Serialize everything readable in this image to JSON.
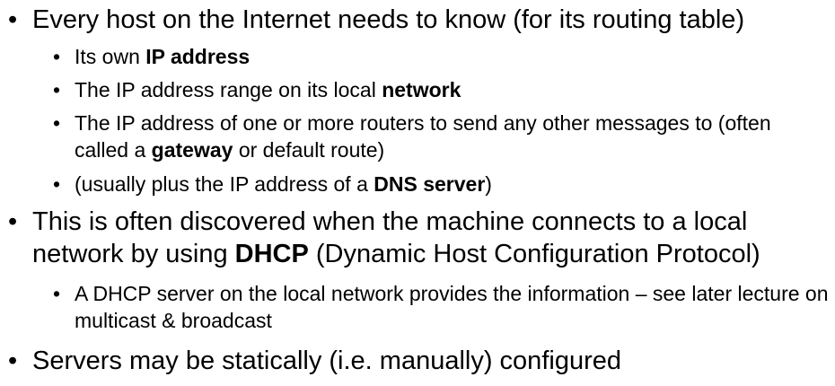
{
  "bullet_glyph": "•",
  "items": [
    {
      "id": "b1_1",
      "parts": [
        "Every host on the Internet needs to know (for its routing table)"
      ]
    },
    {
      "id": "b2_1",
      "parts": [
        "Its own ",
        "IP address"
      ]
    },
    {
      "id": "b2_2",
      "parts": [
        "The IP address range on its local ",
        "network"
      ]
    },
    {
      "id": "b2_3",
      "parts": [
        "The IP address of one or more routers to send any other messages to (often called a ",
        "gateway",
        " or default route)"
      ]
    },
    {
      "id": "b2_4",
      "parts": [
        "(usually plus the IP address of a ",
        "DNS server",
        ")"
      ]
    },
    {
      "id": "b1_2",
      "parts": [
        "This is often discovered when the machine connects to a local network by using ",
        "DHCP",
        " (Dynamic Host Configuration Protocol)"
      ]
    },
    {
      "id": "b2_5",
      "parts": [
        "A DHCP server on the local network provides the information – see later lecture on multicast & broadcast"
      ]
    },
    {
      "id": "b1_3",
      "parts": [
        "Servers may be statically (i.e. manually) configured"
      ]
    }
  ]
}
